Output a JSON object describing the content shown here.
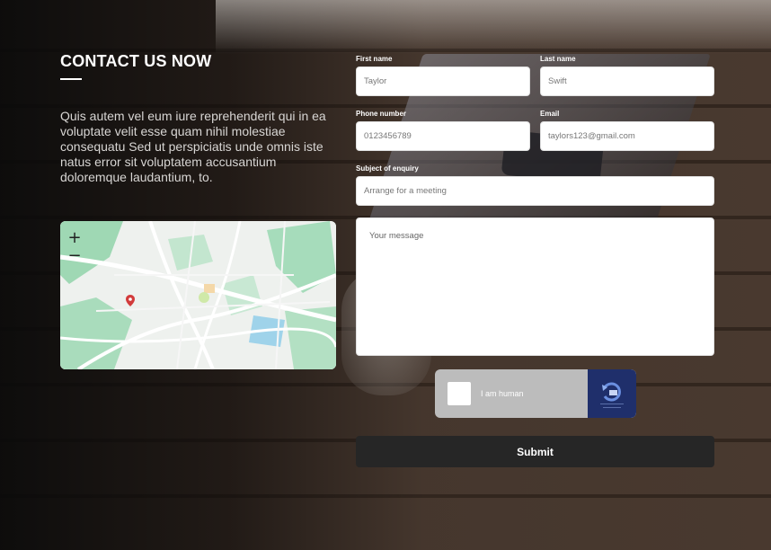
{
  "contact": {
    "title": "CONTACT US NOW",
    "description": "Quis autem vel eum iure reprehenderit qui in ea voluptate velit esse quam nihil molestiae consequatu Sed ut perspiciatis unde omnis iste natus error sit voluptatem accusantium doloremque laudantium, to."
  },
  "map": {
    "zoom_in": "+",
    "zoom_out": "−"
  },
  "form": {
    "first_name": {
      "label": "First name",
      "placeholder": "Taylor"
    },
    "last_name": {
      "label": "Last name",
      "placeholder": "Swift"
    },
    "phone": {
      "label": "Phone number",
      "placeholder": "0123456789"
    },
    "email": {
      "label": "Email",
      "placeholder": "taylors123@gmail.com"
    },
    "subject": {
      "label": "Subject of enquiry",
      "placeholder": "Arrange for a meeting"
    },
    "message": {
      "placeholder": "Your message"
    },
    "captcha_label": "I am human",
    "submit_label": "Submit"
  },
  "colors": {
    "submit_bg": "#262626",
    "captcha_bg": "#bcbcbc",
    "captcha_logo_bg": "#1f2f6b",
    "map_marker": "#d23b3b"
  }
}
